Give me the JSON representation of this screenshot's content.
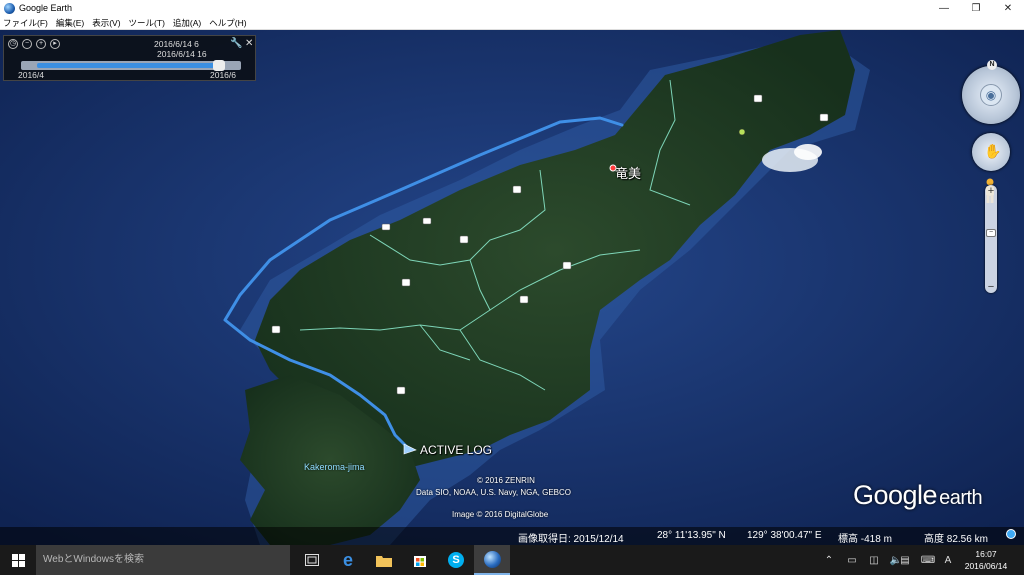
{
  "window": {
    "title": "Google Earth",
    "minimize_glyph": "—",
    "maximize_glyph": "❐",
    "close_glyph": "✕"
  },
  "menu": {
    "items": [
      {
        "label": "ファイル(F)"
      },
      {
        "label": "編集(E)"
      },
      {
        "label": "表示(V)"
      },
      {
        "label": "ツール(T)"
      },
      {
        "label": "追加(A)"
      },
      {
        "label": "ヘルプ(H)"
      }
    ]
  },
  "time_slider": {
    "current_date": "2016/6/14   6",
    "current_time": "2016/6/14  16",
    "range_start": "2016/4",
    "range_end": "2016/6",
    "progress": 0.9
  },
  "map": {
    "place_label": "竜美",
    "track_label": "ACTIVE LOG",
    "island_label": "Kakeroma-jima",
    "copyright_lines": [
      "© 2016 ZENRIN",
      "Data SIO, NOAA, U.S. Navy, NGA, GEBCO",
      "Image © 2016 DigitalGlobe"
    ],
    "logo_main": "Google",
    "logo_sub": "earth",
    "colors": {
      "ocean": "#142c63",
      "land": "#1d3a22",
      "track": "#3f8fe6",
      "river": "#8ef0d2"
    }
  },
  "status": {
    "image_date": "画像取得日: 2015/12/14",
    "lat": "28°  11'13.95\" N",
    "lon": "129°  38'00.47\" E",
    "elevation": "標高  -418 m",
    "altitude": "高度   82.56 km"
  },
  "nav": {
    "north_label": "N"
  },
  "taskbar": {
    "search_placeholder": "WebとWindowsを検索",
    "time": "16:07",
    "date": "2016/06/14",
    "ime_label": "A"
  }
}
